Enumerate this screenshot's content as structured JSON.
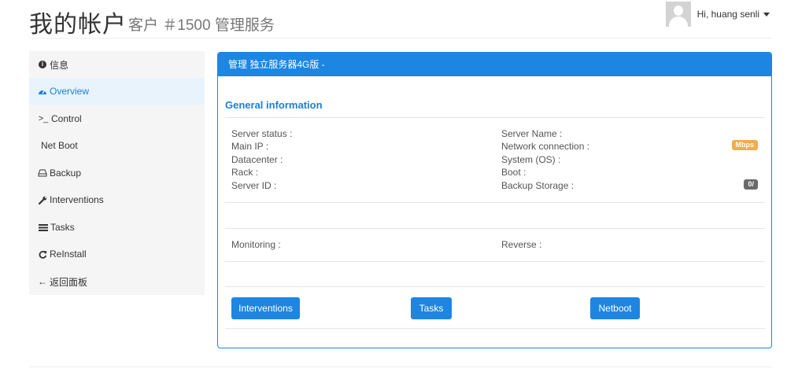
{
  "header": {
    "title": "我的帐户",
    "subtitle": "客户 ＃1500 管理服务",
    "user": "Hi, huang senli"
  },
  "sidebar": {
    "items": [
      {
        "label": "信息",
        "icon": "info-circle-icon"
      },
      {
        "label": "Overview",
        "icon": "dashboard-icon"
      },
      {
        "label": "Control",
        "icon": "terminal-icon"
      },
      {
        "label": "Net Boot",
        "icon": ""
      },
      {
        "label": "Backup",
        "icon": "hdd-icon"
      },
      {
        "label": "Interventions",
        "icon": "wrench-icon"
      },
      {
        "label": "Tasks",
        "icon": "tasks-icon"
      },
      {
        "label": "ReInstall",
        "icon": "refresh-icon"
      },
      {
        "label": "返回面板",
        "icon": "arrow-left-icon"
      }
    ],
    "active_index": 1
  },
  "panel": {
    "heading": "管理 独立服务器4G版 -",
    "section_title": "General information",
    "left_labels": [
      "Server status :",
      "Main IP :",
      "Datacenter :",
      "Rack :",
      "Server ID :"
    ],
    "right_labels": [
      "Server Name :",
      "Network connection :",
      "System (OS) :",
      "Boot :",
      "Backup Storage :"
    ],
    "network_badge": "Mbps",
    "backup_badge": "0/",
    "monitoring_label": "Monitoring :",
    "reverse_label": "Reverse :",
    "buttons": {
      "interventions": "Interventions",
      "tasks": "Tasks",
      "netboot": "Netboot"
    }
  },
  "colors": {
    "primary": "#1c86e2",
    "active_bg": "#e8f3fc",
    "sidebar_bg": "#f5f5f5",
    "badge_orange": "#f0ad4e",
    "badge_grey": "#6a6a6a"
  }
}
